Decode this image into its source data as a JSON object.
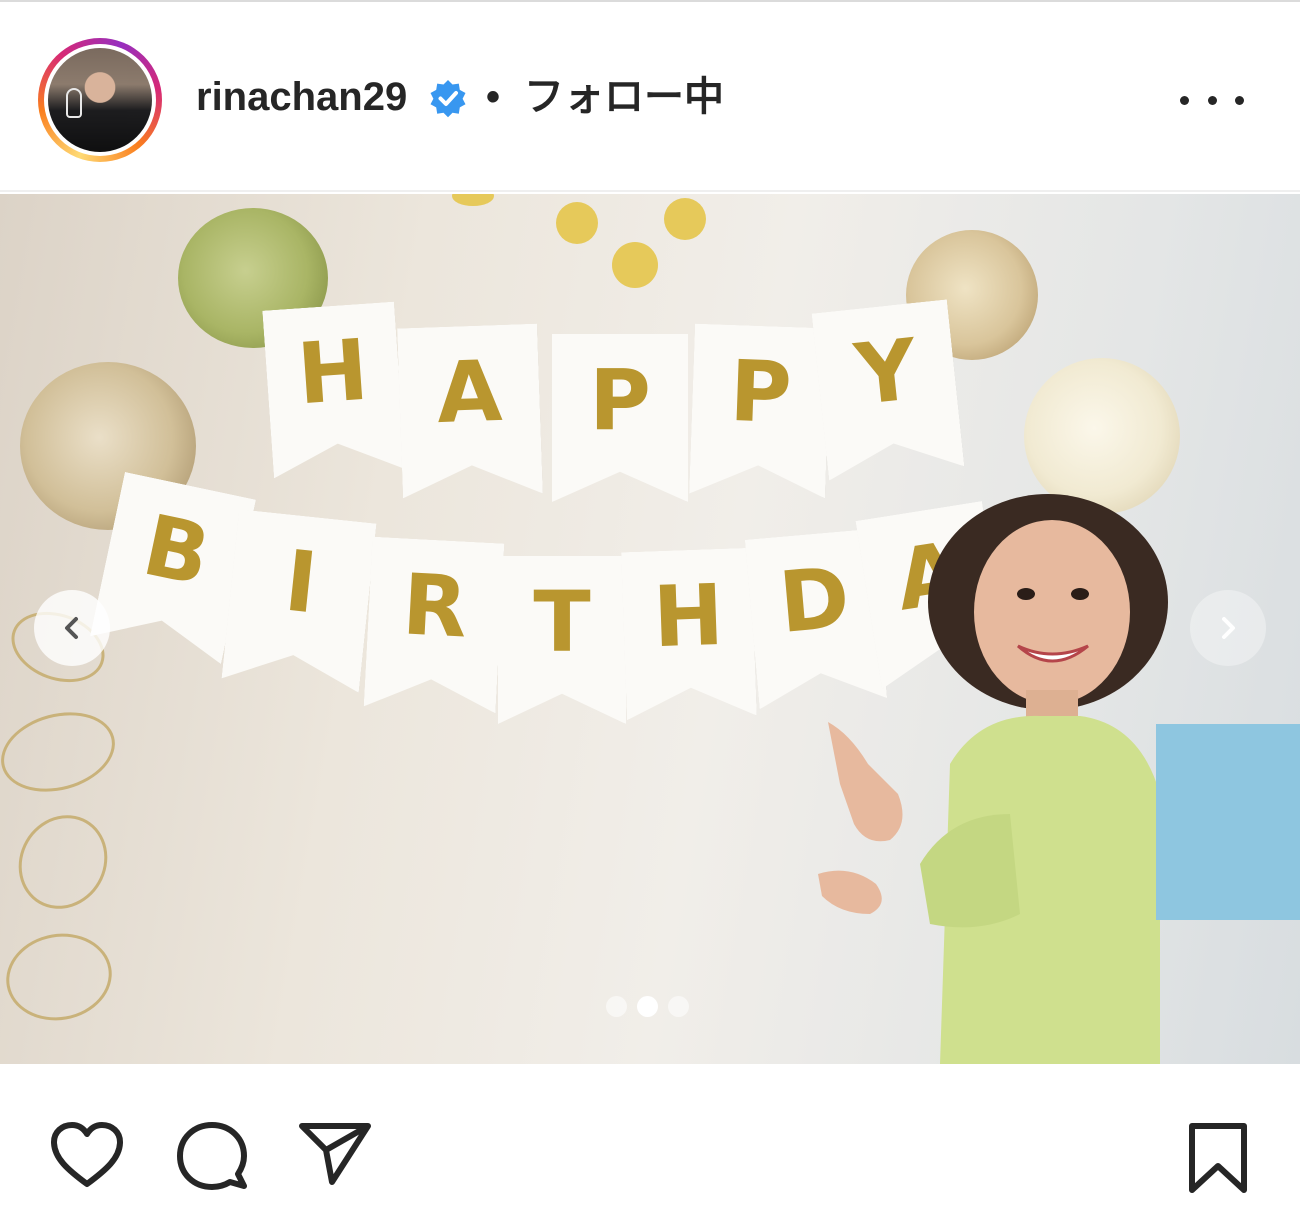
{
  "post": {
    "username": "rinachan29",
    "separator": "•",
    "follow_status": "フォロー中",
    "verified": true
  },
  "carousel": {
    "current_slide": 2,
    "total_slides": 3
  },
  "photo": {
    "banner_top": [
      "H",
      "A",
      "P",
      "P",
      "Y"
    ],
    "banner_bottom": [
      "B",
      "I",
      "R",
      "T",
      "H",
      "D",
      "A"
    ]
  },
  "icons": {
    "more": "more-options-icon",
    "prev": "chevron-left-icon",
    "next": "chevron-right-icon",
    "like": "heart-icon",
    "comment": "comment-icon",
    "share": "send-icon",
    "save": "bookmark-icon"
  },
  "colors": {
    "verified_badge": "#3897f0",
    "text": "#262626",
    "gold_letters": "#b9962f"
  }
}
